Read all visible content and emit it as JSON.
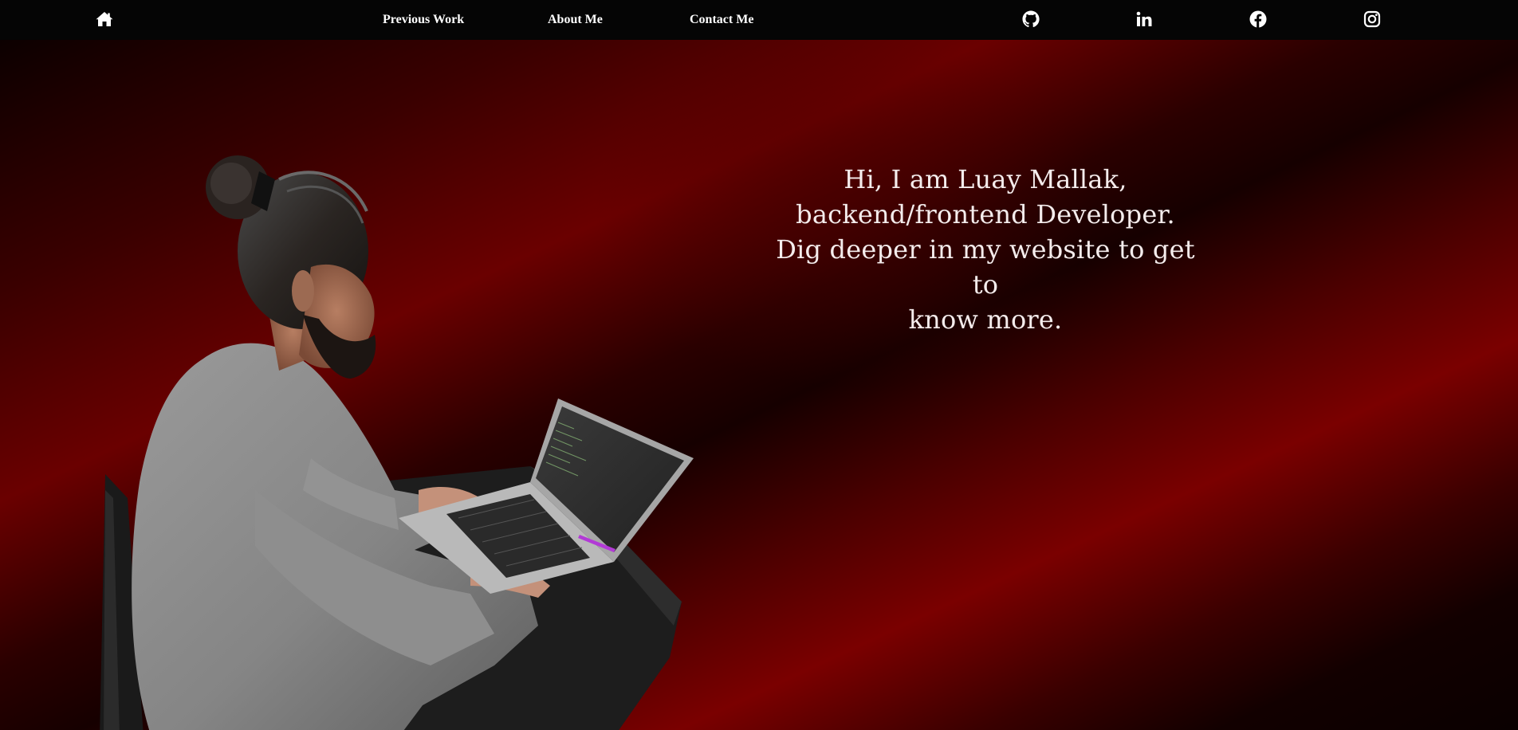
{
  "nav": {
    "home_icon": "home-icon",
    "links": [
      {
        "label": "Previous Work"
      },
      {
        "label": "About Me"
      },
      {
        "label": "Contact Me"
      }
    ],
    "social_icons": [
      "github-icon",
      "linkedin-icon",
      "facebook-icon",
      "instagram-icon"
    ]
  },
  "hero": {
    "lines": [
      "Hi, I am Luay Mallak,",
      "backend/frontend Developer.",
      "Dig deeper in my website to get to",
      "know more."
    ]
  },
  "colors": {
    "navbar": "#050505",
    "accent_red": "#7a0000",
    "text": "#f4ecec"
  }
}
